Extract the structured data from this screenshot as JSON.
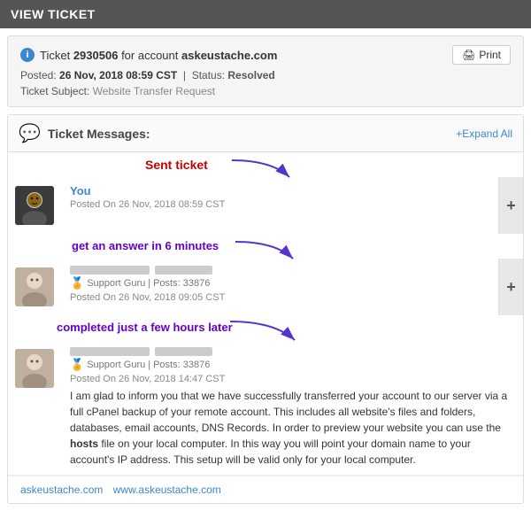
{
  "header": {
    "title": "VIEW TICKET"
  },
  "ticket": {
    "info_icon": "i",
    "prefix": "Ticket",
    "number": "2930506",
    "for_text": "for account",
    "account": "askeustache.com",
    "print_label": "Print",
    "posted_label": "Posted:",
    "posted_date": "26 Nov, 2018 08:59 CST",
    "separator": "|",
    "status_label": "Status:",
    "status_value": "Resolved",
    "subject_label": "Ticket Subject:",
    "subject_value": "Website Transfer Request"
  },
  "messages": {
    "section_title": "Ticket Messages:",
    "expand_all": "+Expand All",
    "items": [
      {
        "sender": "You",
        "avatar_type": "user",
        "posted_on": "Posted On 26 Nov, 2018 08:59 CST",
        "annotation": "Sent ticket",
        "annotation_color": "red",
        "has_plus": true,
        "blurred": false
      },
      {
        "sender": "",
        "avatar_type": "support",
        "role": "Support Guru",
        "posts": "Posts: 33876",
        "posted_on": "Posted On 26 Nov, 2018 09:05 CST",
        "annotation": "get an answer in 6 minutes",
        "annotation_color": "purple",
        "has_plus": true,
        "blurred": true,
        "blurred_width1": 90,
        "blurred_width2": 70
      },
      {
        "sender": "",
        "avatar_type": "support",
        "role": "Support Guru",
        "posts": "Posts: 33876",
        "posted_on": "Posted On 26 Nov, 2018 14:47 CST",
        "annotation": "completed just a  few hours later",
        "annotation_color": "purple",
        "has_plus": false,
        "blurred": true,
        "blurred_width1": 90,
        "blurred_width2": 70,
        "body": "I am glad to inform you that we have successfully transferred your account to our server via a full cPanel backup of your remote account. This includes all website's files and folders, databases, email accounts, DNS Records. In order to preview your website you can use the hosts file on your local computer. In this way you will point your domain name to your account's IP address. This setup will be valid only for your local computer."
      }
    ]
  },
  "footer": {
    "links": [
      "askeustache.com",
      "www.askeustache.com"
    ]
  },
  "icons": {
    "print": "🖨",
    "chat": "💬",
    "medal": "🏅",
    "plus": "+"
  }
}
